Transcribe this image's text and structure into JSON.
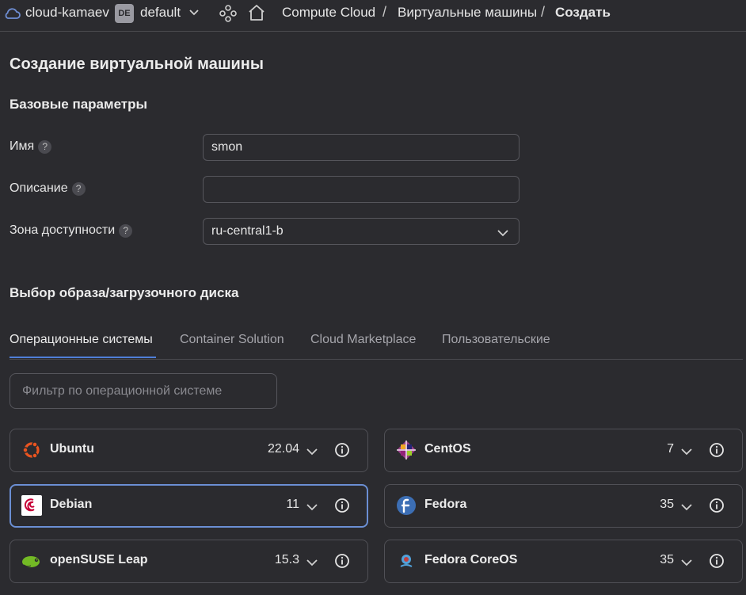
{
  "topbar": {
    "cloud_name": "cloud-kamaev",
    "folder_badge": "DE",
    "folder_name": "default",
    "breadcrumbs": [
      "Compute Cloud",
      "Виртуальные машины",
      "Создать"
    ],
    "separator": "/"
  },
  "page": {
    "title": "Создание виртуальной машины",
    "basic_section": "Базовые параметры",
    "image_section": "Выбор образа/загрузочного диска"
  },
  "form": {
    "name": {
      "label": "Имя",
      "value": "smon",
      "help": "?"
    },
    "description": {
      "label": "Описание",
      "value": "",
      "help": "?"
    },
    "zone": {
      "label": "Зона доступности",
      "value": "ru-central1-b",
      "help": "?"
    }
  },
  "tabs": [
    "Операционные системы",
    "Container Solution",
    "Cloud Marketplace",
    "Пользовательские"
  ],
  "filter": {
    "placeholder": "Фильтр по операционной системе"
  },
  "os_cards": [
    {
      "name": "Ubuntu",
      "version": "22.04",
      "icon": "ubuntu-logo"
    },
    {
      "name": "CentOS",
      "version": "7",
      "icon": "centos-logo"
    },
    {
      "name": "Debian",
      "version": "11",
      "icon": "debian-logo",
      "selected": true
    },
    {
      "name": "Fedora",
      "version": "35",
      "icon": "fedora-logo"
    },
    {
      "name": "openSUSE Leap",
      "version": "15.3",
      "icon": "opensuse-logo"
    },
    {
      "name": "Fedora CoreOS",
      "version": "35",
      "icon": "fedora-coreos-logo"
    }
  ],
  "colors": {
    "background": "#2b2b2f",
    "accent": "#4f7fd8",
    "selected_border": "#6b8fd4"
  }
}
